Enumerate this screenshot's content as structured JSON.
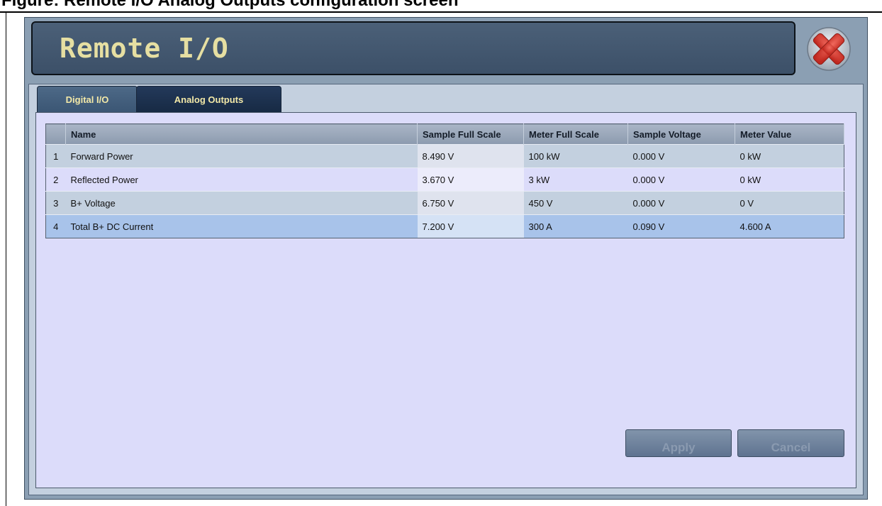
{
  "document": {
    "heading": "Figure: Remote I/O Analog Outputs configuration screen"
  },
  "window": {
    "title": "Remote I/O",
    "close_icon": "red-x-close-icon"
  },
  "tabs": [
    {
      "label": "Digital I/O",
      "active": false
    },
    {
      "label": "Analog Outputs",
      "active": true
    }
  ],
  "table": {
    "columns": [
      "Name",
      "Sample Full Scale",
      "Meter Full Scale",
      "Sample Voltage",
      "Meter Value"
    ],
    "rows": [
      {
        "index": "1",
        "name": "Forward Power",
        "sample_full_scale": "8.490 V",
        "meter_full_scale": "100 kW",
        "sample_voltage": "0.000 V",
        "meter_value": "0 kW"
      },
      {
        "index": "2",
        "name": "Reflected Power",
        "sample_full_scale": "3.670 V",
        "meter_full_scale": "3 kW",
        "sample_voltage": "0.000 V",
        "meter_value": "0 kW"
      },
      {
        "index": "3",
        "name": "B+ Voltage",
        "sample_full_scale": "6.750 V",
        "meter_full_scale": "450 V",
        "sample_voltage": "0.000 V",
        "meter_value": "0 V"
      },
      {
        "index": "4",
        "name": "Total B+ DC Current",
        "sample_full_scale": "7.200 V",
        "meter_full_scale": "300 A",
        "sample_voltage": "0.090 V",
        "meter_value": "4.600 A",
        "selected": true
      }
    ]
  },
  "buttons": {
    "apply": "Apply",
    "cancel": "Cancel"
  },
  "colors": {
    "title_text": "#e6dfa2",
    "tab_text": "#f3e9a8",
    "content_bg": "#dcdcfa",
    "selected_row": "#a8c3ea",
    "close_icon": "#d8342b"
  }
}
